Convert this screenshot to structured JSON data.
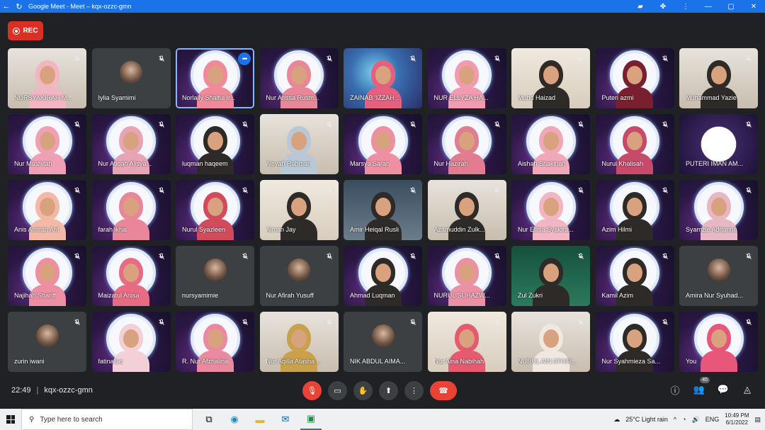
{
  "window": {
    "title": "Google Meet - Meet – kqx-ozzc-gmn",
    "back_icon": "arrow-left-icon",
    "reload_icon": "reload-icon"
  },
  "recording": {
    "label": "REC"
  },
  "participants": [
    {
      "name": "NURSYAKIRAH M...",
      "bg": "room2",
      "hijab": "#f2b6c3"
    },
    {
      "name": "Iylia Syamimi",
      "bg": "avatar"
    },
    {
      "name": "Norlaily Shaiful Ir...",
      "bg": "cosmic",
      "hijab": "#f08a9a",
      "active": true
    },
    {
      "name": "Nur Arissa Rusm...",
      "bg": "cosmic",
      "hijab": "#e88798"
    },
    {
      "name": "ZAINAB 'IZZAH ...",
      "bg": "space",
      "hijab": "#e5607f"
    },
    {
      "name": "NUR ELLYZA HA...",
      "bg": "cosmic",
      "hijab": "#f29ab0"
    },
    {
      "name": "Muhd Haizad",
      "bg": "room",
      "hijab": "#2d2a28"
    },
    {
      "name": "Puteri azmi",
      "bg": "cosmic",
      "hijab": "#7a1f2f"
    },
    {
      "name": "Muhammad Yazie",
      "bg": "room2",
      "hijab": "#2d2a28"
    },
    {
      "name": "Nur Mashitah",
      "bg": "cosmic",
      "hijab": "#f0a0b5"
    },
    {
      "name": "Nur Atiqah Alisya...",
      "bg": "cosmic",
      "hijab": "#e8a3b5"
    },
    {
      "name": "luqman haqeem",
      "bg": "cosmic",
      "hijab": "#2d2a28"
    },
    {
      "name": "Aisyah Rahman",
      "bg": "room2",
      "hijab": "#b9c7d6"
    },
    {
      "name": "Marsya Sarah",
      "bg": "cosmic",
      "hijab": "#ee8fa3"
    },
    {
      "name": "Nur Hazirah",
      "bg": "cosmic",
      "hijab": "#e27c90"
    },
    {
      "name": "Aishah Shakinah",
      "bg": "cosmic",
      "hijab": "#f0a7b7"
    },
    {
      "name": "Nurul Khalisah",
      "bg": "cosmic",
      "hijab": "#c84a6a"
    },
    {
      "name": "PUTERI IMAN AM...",
      "bg": "hearts"
    },
    {
      "name": "Anis Amirah Arif",
      "bg": "cosmic",
      "hijab": "#f4b9a6"
    },
    {
      "name": "farah ikha",
      "bg": "cosmic",
      "hijab": "#e98699"
    },
    {
      "name": "Nurul Syazleen",
      "bg": "cosmic",
      "hijab": "#d24b5d"
    },
    {
      "name": "Aiman Jay",
      "bg": "room",
      "hijab": "#2d2a28"
    },
    {
      "name": "Amir Heiqal Rusli",
      "bg": "car",
      "hijab": "#2d2a28"
    },
    {
      "name": "Azamuddin Zulk...",
      "bg": "room2",
      "hijab": "#2d2a28"
    },
    {
      "name": "Nur Ellisa Syakira...",
      "bg": "cosmic",
      "hijab": "#f3b4c4"
    },
    {
      "name": "Azim Hilmi",
      "bg": "cosmic",
      "hijab": "#2d2a28"
    },
    {
      "name": "Syamzie Adrianna",
      "bg": "cosmic",
      "hijab": "#e7b7c4"
    },
    {
      "name": "Najihah Shariff",
      "bg": "cosmic",
      "hijab": "#ee8ea2"
    },
    {
      "name": "Maizatul Anisa",
      "bg": "cosmic",
      "hijab": "#e86b83"
    },
    {
      "name": "nursyamimie",
      "bg": "avatar"
    },
    {
      "name": "Nur Afirah Yusuff",
      "bg": "avatar"
    },
    {
      "name": "Ahmad Luqman",
      "bg": "cosmic",
      "hijab": "#2d2a28"
    },
    {
      "name": "NURUL SUHAZW...",
      "bg": "cosmic",
      "hijab": "#ec91a5"
    },
    {
      "name": "Zul Zukri",
      "bg": "party",
      "hijab": "#2d2a28"
    },
    {
      "name": "Kamil Azim",
      "bg": "cosmic",
      "hijab": "#2d2a28"
    },
    {
      "name": "Amira Nur Syuhad...",
      "bg": "avatar"
    },
    {
      "name": "zurin iwani",
      "bg": "avatar"
    },
    {
      "name": "fatinalias",
      "bg": "cosmic",
      "hijab": "#f3cfd7"
    },
    {
      "name": "R. Nur Afzhalina",
      "bg": "cosmic",
      "hijab": "#ea8aa0"
    },
    {
      "name": "Nur Aqilla Atasha ...",
      "bg": "room2",
      "hijab": "#c9a14a"
    },
    {
      "name": "NIK ABDUL AIMA...",
      "bg": "avatar"
    },
    {
      "name": "Nur Aina Nabihah",
      "bg": "room",
      "hijab": "#e55a6e"
    },
    {
      "name": "NURUL AIN ATHIR...",
      "bg": "room2",
      "hijab": "#efe7e0"
    },
    {
      "name": "Nur Syahmieza Sa...",
      "bg": "cosmic",
      "hijab": "#2d2a28"
    },
    {
      "name": "You",
      "bg": "cosmic",
      "hijab": "#e6577a"
    }
  ],
  "footer": {
    "time": "22:49",
    "separator": "|",
    "meeting_code": "kqx-ozzc-gmn",
    "participant_count": "45"
  },
  "taskbar": {
    "search_placeholder": "Type here to search",
    "weather": "25°C  Light rain",
    "language": "ENG",
    "clock_time": "10:49 PM",
    "clock_date": "6/1/2022"
  },
  "colors": {
    "meet_bg": "#202124",
    "tile_bg": "#3c4043",
    "rec_red": "#d93025",
    "end_call_red": "#ea4335",
    "chrome_blue": "#1a73e8"
  }
}
